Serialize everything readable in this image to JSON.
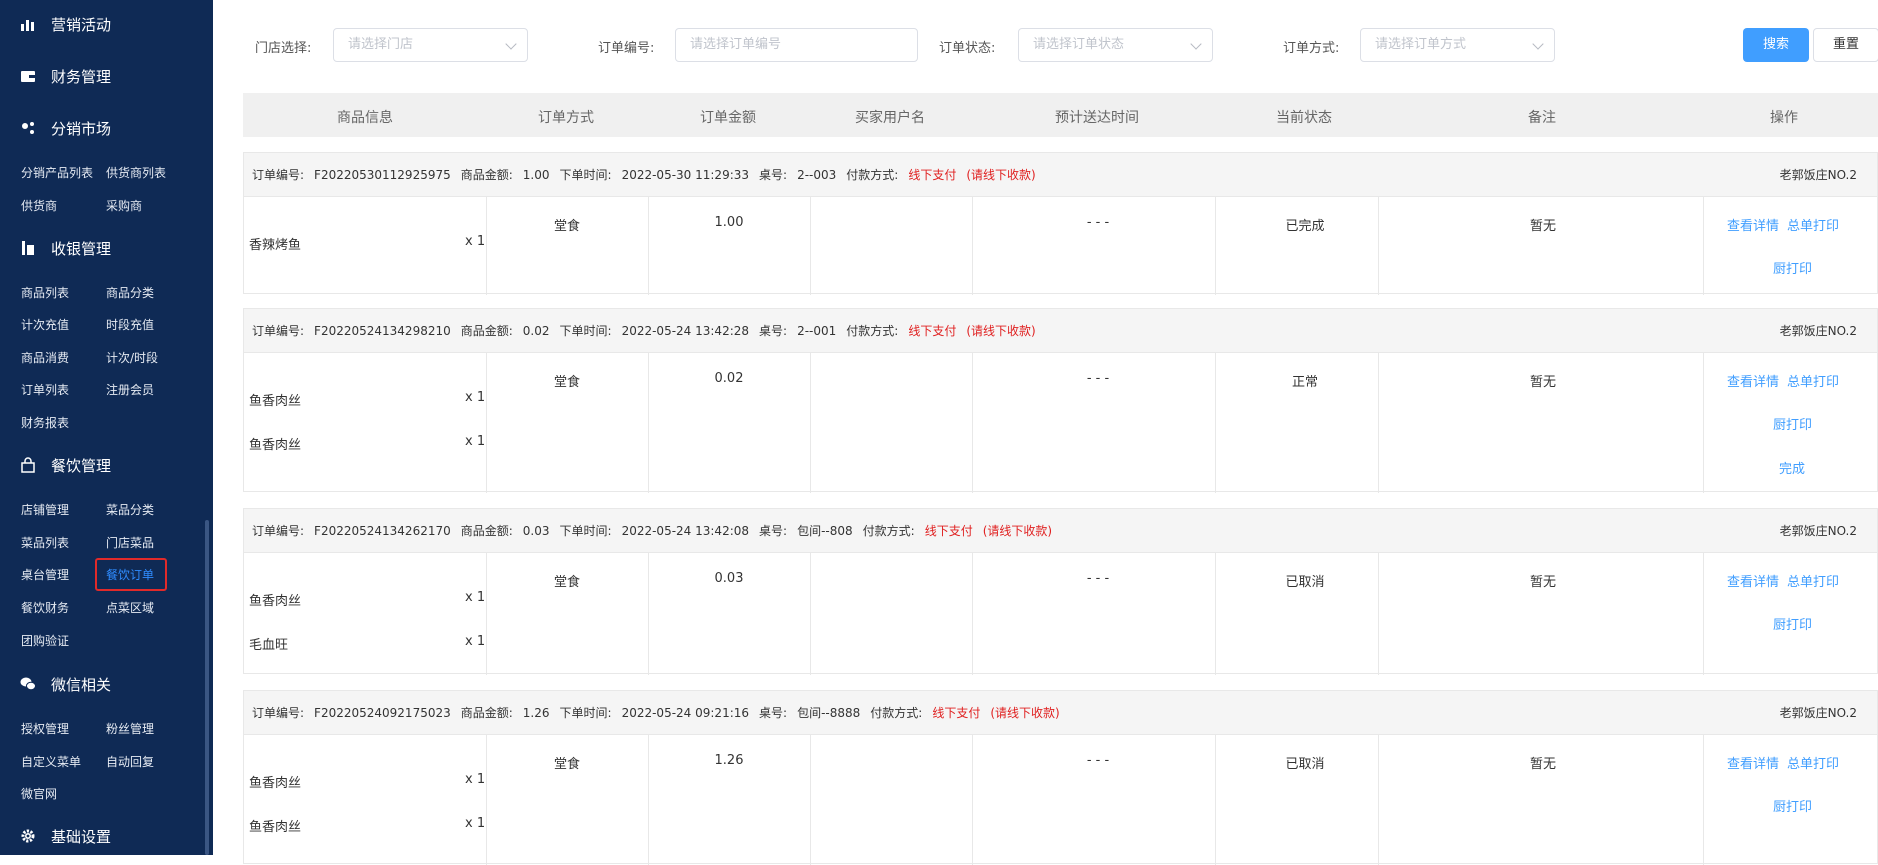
{
  "sidebar": {
    "sections": [
      {
        "label": "营销活动",
        "icon": "bar-chart-icon"
      },
      {
        "label": "财务管理",
        "icon": "wallet-icon"
      },
      {
        "label": "分销市场",
        "icon": "distribution-icon"
      },
      {
        "label": "收银管理",
        "icon": "cashier-icon"
      },
      {
        "label": "餐饮管理",
        "icon": "shopping-bag-icon"
      },
      {
        "label": "微信相关",
        "icon": "wechat-icon"
      },
      {
        "label": "基础设置",
        "icon": "gear-icon"
      }
    ],
    "distribution": [
      "分销产品列表",
      "供货商列表",
      "供货商",
      "采购商"
    ],
    "cashier": [
      "商品列表",
      "商品分类",
      "计次充值",
      "时段充值",
      "商品消费",
      "计次/时段",
      "订单列表",
      "注册会员",
      "财务报表"
    ],
    "catering": [
      "店铺管理",
      "菜品分类",
      "菜品列表",
      "门店菜品",
      "桌台管理",
      "餐饮订单",
      "餐饮财务",
      "点菜区域",
      "团购验证"
    ],
    "wechat": [
      "授权管理",
      "粉丝管理",
      "自定义菜单",
      "自动回复",
      "微官网"
    ]
  },
  "filters": {
    "store_label": "门店选择:",
    "store_placeholder": "请选择门店",
    "order_no_label": "订单编号:",
    "order_no_placeholder": "请选择订单编号",
    "status_label": "订单状态:",
    "status_placeholder": "请选择订单状态",
    "method_label": "订单方式:",
    "method_placeholder": "请选择订单方式",
    "search": "搜索",
    "reset": "重置"
  },
  "columns": [
    "商品信息",
    "订单方式",
    "订单金额",
    "买家用户名",
    "预计送达时间",
    "当前状态",
    "备注",
    "操作"
  ],
  "labels": {
    "order_no": "订单编号:",
    "amount": "商品金额:",
    "time": "下单时间:",
    "table": "桌号:",
    "pay": "付款方式:"
  },
  "orders": [
    {
      "order_no": "F20220530112925975",
      "amount": "1.00",
      "time": "2022-05-30 11:29:33",
      "table": "2--003",
      "pay_method": "线下支付",
      "pay_note": "(请线下收款)",
      "store": "老郭饭庄NO.2",
      "items": [
        {
          "name": "香辣烤鱼",
          "qty": "x 1"
        }
      ],
      "type": "堂食",
      "total": "1.00",
      "buyer": "",
      "eta": "- - -",
      "status": "已完成",
      "remark": "暂无",
      "actions": [
        "查看详情",
        "总单打印",
        "厨打印"
      ]
    },
    {
      "order_no": "F20220524134298210",
      "amount": "0.02",
      "time": "2022-05-24 13:42:28",
      "table": "2--001",
      "pay_method": "线下支付",
      "pay_note": "(请线下收款)",
      "store": "老郭饭庄NO.2",
      "items": [
        {
          "name": "鱼香肉丝",
          "qty": "x 1"
        },
        {
          "name": "鱼香肉丝",
          "qty": "x 1"
        }
      ],
      "type": "堂食",
      "total": "0.02",
      "buyer": "",
      "eta": "- - -",
      "status": "正常",
      "remark": "暂无",
      "actions": [
        "查看详情",
        "总单打印",
        "厨打印",
        "完成"
      ]
    },
    {
      "order_no": "F20220524134262170",
      "amount": "0.03",
      "time": "2022-05-24 13:42:08",
      "table": "包间--808",
      "pay_method": "线下支付",
      "pay_note": "(请线下收款)",
      "store": "老郭饭庄NO.2",
      "items": [
        {
          "name": "鱼香肉丝",
          "qty": "x 1"
        },
        {
          "name": "毛血旺",
          "qty": "x 1"
        }
      ],
      "type": "堂食",
      "total": "0.03",
      "buyer": "",
      "eta": "- - -",
      "status": "已取消",
      "remark": "暂无",
      "actions": [
        "查看详情",
        "总单打印",
        "厨打印"
      ]
    },
    {
      "order_no": "F20220524092175023",
      "amount": "1.26",
      "time": "2022-05-24 09:21:16",
      "table": "包间--8888",
      "pay_method": "线下支付",
      "pay_note": "(请线下收款)",
      "store": "老郭饭庄NO.2",
      "items": [
        {
          "name": "鱼香肉丝",
          "qty": "x 1"
        },
        {
          "name": "鱼香肉丝",
          "qty": "x 1"
        }
      ],
      "type": "堂食",
      "total": "1.26",
      "buyer": "",
      "eta": "- - -",
      "status": "已取消",
      "remark": "暂无",
      "actions": [
        "查看详情",
        "总单打印",
        "厨打印"
      ]
    }
  ],
  "colors": {
    "sidebar_bg": "#0f2a55",
    "accent": "#409eff",
    "alert": "#e02020",
    "highlight_box": "#e12a2a"
  }
}
